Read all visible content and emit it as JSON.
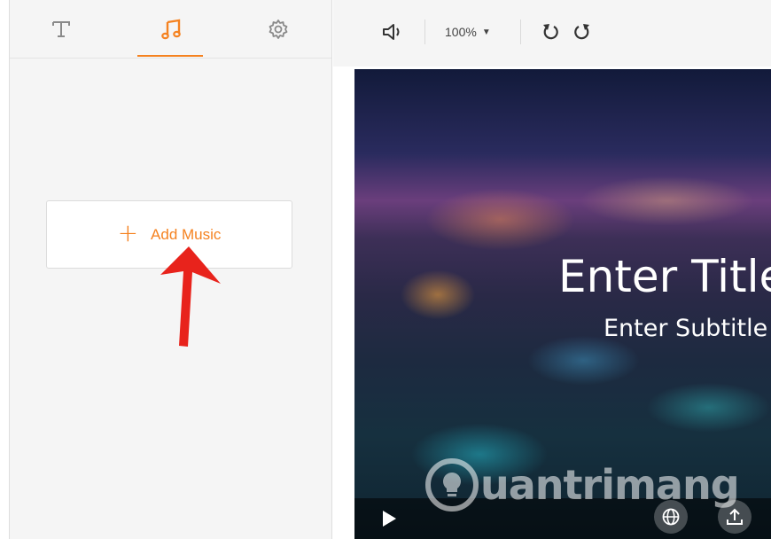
{
  "sidebar": {
    "tabs": [
      {
        "name": "text",
        "icon": "text-icon"
      },
      {
        "name": "music",
        "icon": "music-note-icon",
        "active": true
      },
      {
        "name": "settings",
        "icon": "gear-icon"
      }
    ],
    "add_music_label": "Add Music",
    "add_icon": "+"
  },
  "toolbar": {
    "zoom_value": "100%",
    "zoom_caret": "▼"
  },
  "preview": {
    "title": "Enter Title",
    "subtitle": "Enter Subtitle"
  },
  "watermark": {
    "text": "uantrimang"
  },
  "colors": {
    "accent": "#f58220",
    "annotation_arrow": "#e8231c"
  }
}
